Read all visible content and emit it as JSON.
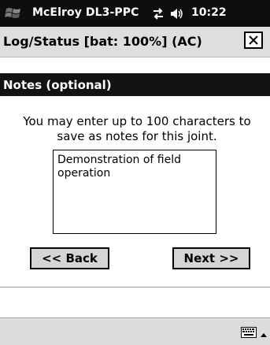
{
  "os_bar": {
    "app_name": "McElroy DL3-PPC",
    "time": "10:22",
    "start_icon": "windows-flag-icon",
    "sync_icon": "sync-arrows-icon",
    "volume_icon": "speaker-icon"
  },
  "window": {
    "title": "Log/Status  [bat: 100%] (AC)",
    "close_icon": "close-icon"
  },
  "section": {
    "header": "Notes (optional)"
  },
  "form": {
    "instructions": "You may enter up to 100 characters to save as notes for this joint.",
    "notes_value": "Demonstration of field operation"
  },
  "buttons": {
    "back_label": "<< Back",
    "next_label": "Next >>"
  },
  "menu_bar": {
    "keyboard_icon": "keyboard-icon",
    "sip_icon": "up-arrow-icon"
  },
  "colors": {
    "os_bar_bg": "#0e0e0e",
    "title_bar_bg": "#dedede",
    "section_header_bg": "#121212",
    "button_bg": "#d5d5d5",
    "menu_bar_bg": "#dcdcdc"
  }
}
